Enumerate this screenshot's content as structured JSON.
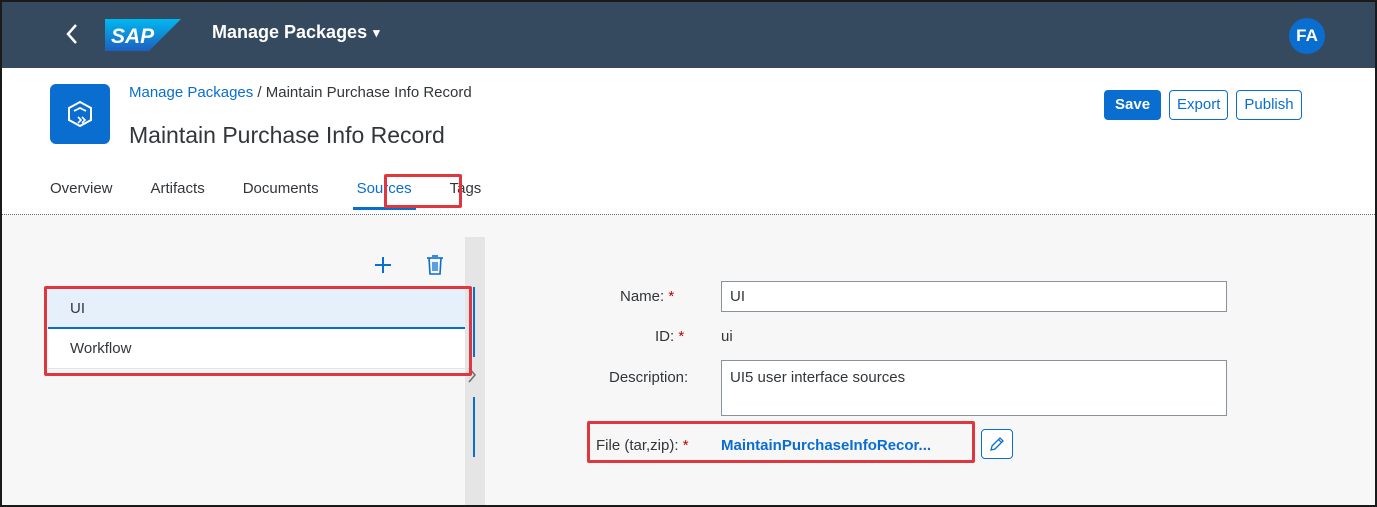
{
  "shell": {
    "back_icon": "chevron-left-icon",
    "logo_text": "SAP",
    "app_title": "Manage Packages",
    "app_title_caret": "▾",
    "avatar_initials": "FA",
    "bar_color": "#354a5f",
    "avatar_color": "#0a6ed1"
  },
  "header": {
    "icon": "package-transport-icon",
    "breadcrumb_link": "Manage Packages",
    "breadcrumb_separator": " / ",
    "breadcrumb_current": "Maintain Purchase Info Record",
    "title": "Maintain Purchase Info Record",
    "actions": {
      "save": "Save",
      "export": "Export",
      "publish": "Publish"
    }
  },
  "tabs": [
    {
      "label": "Overview",
      "selected": false
    },
    {
      "label": "Artifacts",
      "selected": false
    },
    {
      "label": "Documents",
      "selected": false
    },
    {
      "label": "Sources",
      "selected": true
    },
    {
      "label": "Tags",
      "selected": false
    }
  ],
  "master": {
    "add_icon": "plus-icon",
    "delete_icon": "trash-icon",
    "items": [
      {
        "label": "UI",
        "selected": true
      },
      {
        "label": "Workflow",
        "selected": false
      }
    ]
  },
  "detail": {
    "name_label": "Name:",
    "name_value": "UI",
    "id_label": "ID:",
    "id_value": "ui",
    "description_label": "Description:",
    "description_value": "UI5 user interface sources",
    "file_label": "File (tar,zip):",
    "file_value": "MaintainPurchaseInfoRecor...",
    "required_marker": "*",
    "edit_icon": "pencil-icon"
  },
  "colors": {
    "accent": "#0a6ed1",
    "highlight_annotation": "#e0373e",
    "required": "#bb0000"
  }
}
